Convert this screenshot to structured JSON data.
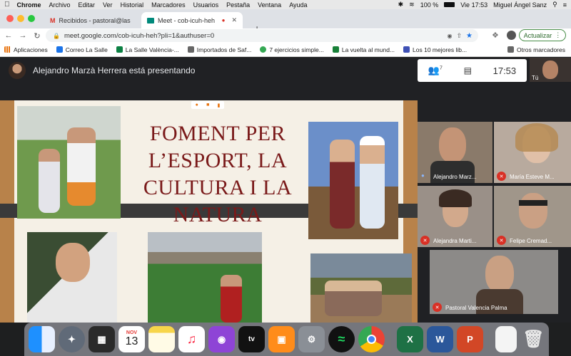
{
  "menubar": {
    "app": "Chrome",
    "items": [
      "Archivo",
      "Editar",
      "Ver",
      "Historial",
      "Marcadores",
      "Usuarios",
      "Pestaña",
      "Ventana",
      "Ayuda"
    ],
    "battery": "100 %",
    "clock": "Vie 17:53",
    "user": "Miguel Ángel Sanz"
  },
  "tabs": [
    {
      "title": "Recibidos - pastoral@lasallevp",
      "icon": "gmail-icon"
    },
    {
      "title": "Meet - cob-icuh-heh",
      "icon": "meet-icon"
    }
  ],
  "toolbar": {
    "url": "meet.google.com/cob-icuh-heh?pli=1&authuser=0",
    "update_label": "Actualizar"
  },
  "bookmarks": {
    "items": [
      {
        "label": "Aplicaciones",
        "color": "#e8710a"
      },
      {
        "label": "Correo La Salle",
        "color": "#1a73e8"
      },
      {
        "label": "La Salle València-...",
        "color": "#0b8043"
      },
      {
        "label": "Importados de Saf...",
        "color": "#666666"
      },
      {
        "label": "7 ejercicios simple...",
        "color": "#34a853"
      },
      {
        "label": "La vuelta al mund...",
        "color": "#188038"
      },
      {
        "label": "Los 10 mejores lib...",
        "color": "#3f51b5"
      }
    ],
    "other": "Otros marcadores"
  },
  "meet": {
    "presenter_text": "Alejandro Marzà Herrera está presentando",
    "participants_count": "7",
    "time": "17:53",
    "self_label": "Tú"
  },
  "slide": {
    "title_lines": [
      "FOMENT PER",
      "L’ESPORT, LA",
      "CULTURA I LA",
      "NATURA"
    ]
  },
  "participants": [
    {
      "name": "Alejandro Marz...",
      "muted": false
    },
    {
      "name": "María Esteve M...",
      "muted": true
    },
    {
      "name": "Alejandra Marti...",
      "muted": true
    },
    {
      "name": "Felipe Cremad...",
      "muted": true
    },
    {
      "name": "Pastoral Valencia Palma",
      "muted": true
    }
  ],
  "dock": {
    "calendar_month": "NOV",
    "calendar_day": "13",
    "apps": [
      "Finder",
      "Launchpad",
      "Mission Control",
      "Calendar",
      "Notes",
      "Music",
      "Podcasts",
      "TV",
      "Books",
      "System Preferences",
      "Spotify",
      "Chrome",
      "Excel",
      "Word",
      "PowerPoint",
      "Preview",
      "Trash"
    ]
  }
}
